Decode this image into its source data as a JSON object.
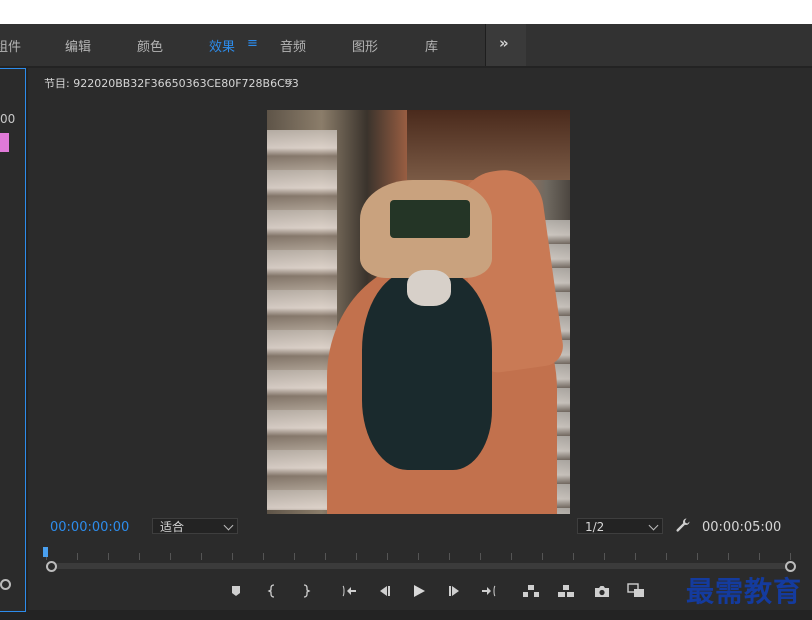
{
  "menubar": {
    "items": [
      "组件",
      "编辑",
      "颜色",
      "效果",
      "音频",
      "图形",
      "库"
    ],
    "active": "效果",
    "more_label": "»"
  },
  "left_panel": {
    "timecode": "00"
  },
  "program_monitor": {
    "title": "节目: 922020BB32F36650363CE80F728B6C93",
    "menu_icon": "≡",
    "current_time": "00:00:00:00",
    "zoom_select": "适合",
    "resolution_select": "1/2",
    "duration": "00:00:05:00"
  },
  "transport": {
    "buttons": [
      "add-marker",
      "mark-in",
      "mark-out",
      "go-to-in",
      "step-back",
      "play",
      "step-forward",
      "go-to-out",
      "lift",
      "extract",
      "export-frame",
      "compare-view"
    ]
  },
  "watermark": "最需教育",
  "colors": {
    "accent": "#2d8ceb",
    "panel": "#2b2b2b",
    "background": "#232323",
    "watermark": "#143b9e",
    "marker": "#e07ad8"
  }
}
